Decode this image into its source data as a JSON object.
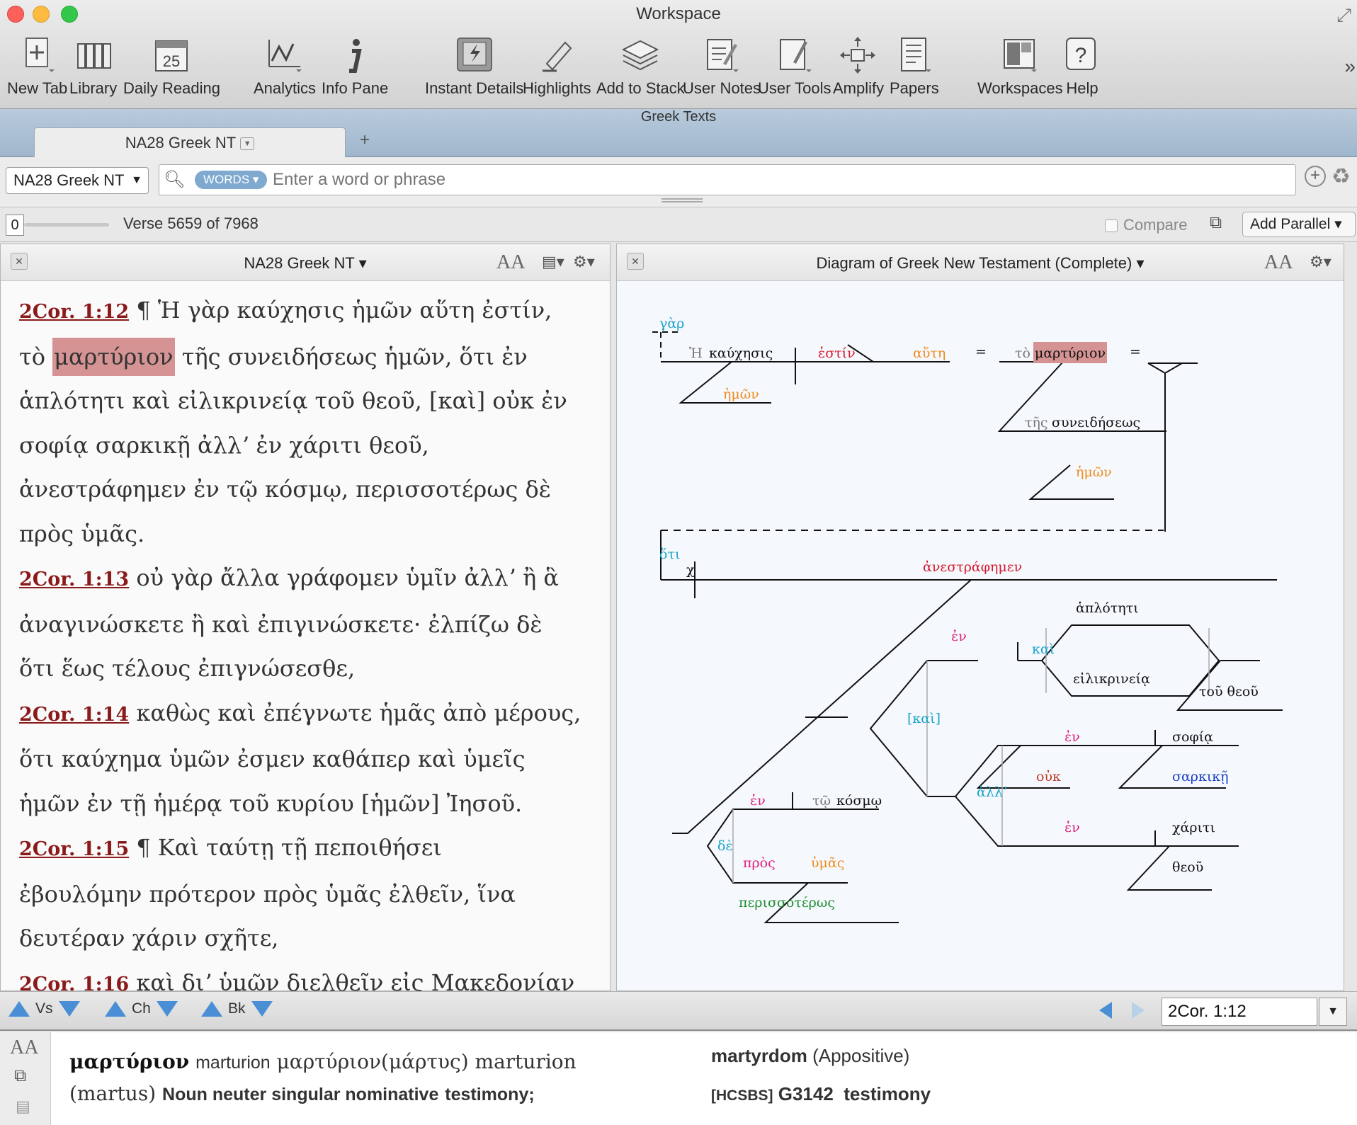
{
  "window": {
    "title": "Workspace"
  },
  "toolbar": {
    "items": [
      {
        "label": "New Tab",
        "icon": "new-tab-icon"
      },
      {
        "label": "Library",
        "icon": "library-icon"
      },
      {
        "label": "Daily Reading",
        "icon": "calendar-icon",
        "day": "25"
      },
      {
        "label": "Analytics",
        "icon": "analytics-icon"
      },
      {
        "label": "Info Pane",
        "icon": "info-icon"
      },
      {
        "label": "Instant Details",
        "icon": "instant-details-icon"
      },
      {
        "label": "Highlights",
        "icon": "highlighter-icon"
      },
      {
        "label": "Add to Stack",
        "icon": "stack-icon"
      },
      {
        "label": "User Notes",
        "icon": "notes-icon"
      },
      {
        "label": "User Tools",
        "icon": "user-tools-icon"
      },
      {
        "label": "Amplify",
        "icon": "amplify-icon"
      },
      {
        "label": "Papers",
        "icon": "papers-icon"
      },
      {
        "label": "Workspaces",
        "icon": "workspaces-icon"
      },
      {
        "label": "Help",
        "icon": "help-icon"
      }
    ]
  },
  "section": {
    "label": "Greek Texts"
  },
  "tabs": [
    {
      "label": "NA28 Greek NT"
    }
  ],
  "search": {
    "resource": "NA28 Greek NT",
    "mode": "WORDS",
    "placeholder": "Enter a word or phrase"
  },
  "verse_bar": {
    "slider_value": "0",
    "position": "Verse 5659 of 7968",
    "compare": "Compare",
    "add_parallel": "Add Parallel"
  },
  "left_pane": {
    "title": "NA28 Greek NT",
    "aa": "AA",
    "lines": [
      {
        "ref": "2Cor. 1:12",
        "text": " ¶    Ἡ γὰρ καύχησις ἡμῶν αὕτη ἐστίν,"
      },
      {
        "pre": "τὸ ",
        "hl": "μαρτύριον",
        "post": " τῆς συνειδήσεως ἡμῶν, ὅτι ἐν"
      },
      {
        "text": "ἁπλότητι καὶ εἰλικρινείᾳ τοῦ θεοῦ, [καὶ] οὐκ ἐν"
      },
      {
        "text": "σοφίᾳ σαρκικῇ ἀλλʼ ἐν χάριτι θεοῦ,"
      },
      {
        "text": "ἀνεστράφημεν ἐν τῷ κόσμῳ, περισσοτέρως δὲ"
      },
      {
        "text": "πρὸς ὑμᾶς."
      },
      {
        "ref": "2Cor. 1:13",
        "text": " οὐ γὰρ ἄλλα γράφομεν ὑμῖν ἀλλʼ ἢ ἃ"
      },
      {
        "text": "ἀναγινώσκετε ἢ καὶ ἐπιγινώσκετε· ἐλπίζω δὲ"
      },
      {
        "text": "ὅτι ἕως τέλους ἐπιγνώσεσθε,"
      },
      {
        "ref": "2Cor. 1:14",
        "text": " καθὼς καὶ ἐπέγνωτε ἡμᾶς ἀπὸ μέρους,"
      },
      {
        "text": "ὅτι καύχημα ὑμῶν ἐσμεν καθάπερ καὶ ὑμεῖς"
      },
      {
        "text": "ἡμῶν ἐν τῇ ἡμέρᾳ τοῦ κυρίου [ἡμῶν] Ἰησοῦ."
      },
      {
        "ref": "2Cor. 1:15",
        "text": " ¶    Καὶ ταύτῃ τῇ πεποιθήσει"
      },
      {
        "text": "ἐβουλόμην πρότερον πρὸς ὑμᾶς ἐλθεῖν, ἵνα"
      },
      {
        "text": "δευτέραν χάριν σχῆτε,"
      },
      {
        "ref": "2Cor. 1:16",
        "text": " καὶ διʼ ὑμῶν διελθεῖν εἰς Μακεδονίαν"
      }
    ]
  },
  "right_pane": {
    "title": "Diagram of Greek New Testament (Complete)",
    "aa": "AA",
    "words": {
      "gar": "γὰρ",
      "he": "Ἡ",
      "kauchesis": "καύχησις",
      "estin": "ἐστίν",
      "aute": "αὕτη",
      "eq": "=",
      "to": "τὸ",
      "martyrion": "μαρτύριον",
      "hemon1": "ἡμῶν",
      "tes": "τῆς",
      "syneideseos": "συνειδήσεως",
      "hemon2": "ἡμῶν",
      "hoti": "ὅτι",
      "chi": "χ",
      "anestraphemen": "ἀνεστράφημεν",
      "haploteti": "ἁπλότητι",
      "en1": "ἐν",
      "kai1": "καὶ",
      "eilikrineia": "εἰλικρινείᾳ",
      "tou_theou": "τοῦ θεοῦ",
      "kai2": "[καὶ]",
      "en2": "ἐν",
      "sophia": "σοφίᾳ",
      "ouk": "οὐκ",
      "sarkike": "σαρκικῇ",
      "all": "ἀλλʼ",
      "en3": "ἐν",
      "chariti": "χάριτι",
      "theou": "θεοῦ",
      "en4": "ἐν",
      "to_kosmo_art": "τῷ",
      "kosmo": "κόσμῳ",
      "de": "δὲ",
      "pros": "πρὸς",
      "hymas": "ὑμᾶς",
      "perissoteros": "περισσοτέρως"
    }
  },
  "nav": {
    "verse": "Vs",
    "chapter": "Ch",
    "book": "Bk",
    "reference": "2Cor. 1:12"
  },
  "info": {
    "aa": "AA",
    "word": "μαρτύριον",
    "translit": "marturion",
    "lemma": "μαρτύριον",
    "lemma_root": "(μάρτυς)",
    "lemma_translit": "marturion",
    "root_translit": "(martus)",
    "morph": "Noun neuter singular nominative",
    "gloss": "testimony;",
    "sense": "martyrdom",
    "sense_role": "(Appositive)",
    "hcsbs": "[HCSBS]",
    "strongs": "G3142",
    "strongs_gloss": "testimony"
  },
  "colors": {
    "verse_ref": "#8b1a1a",
    "highlight": "#d59393",
    "accent": "#4a8fd6",
    "conj": "#1aa3c9",
    "verb": "#d6192f",
    "modifier": "#f08a1e",
    "prep": "#e0207e",
    "adverb": "#1e8c2e",
    "adjective": "#1b3fc4"
  }
}
